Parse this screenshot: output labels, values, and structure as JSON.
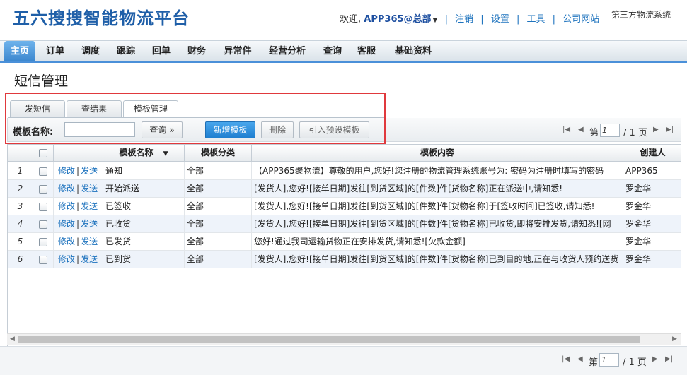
{
  "header": {
    "logo": "五六搜搜智能物流平台",
    "welcome": "欢迎,",
    "user": "APP365@总部",
    "links": [
      "注销",
      "设置",
      "工具",
      "公司网站"
    ],
    "system": "第三方物流系统"
  },
  "nav": {
    "items": [
      "主页",
      "订单",
      "调度",
      "跟踪",
      "回单",
      "财务",
      "异常件",
      "经营分析",
      "查询",
      "客服",
      "基础资料"
    ],
    "active": "主页"
  },
  "page_title": "短信管理",
  "tabs": {
    "items": [
      "发短信",
      "查结果",
      "模板管理"
    ],
    "active": "模板管理"
  },
  "toolbar": {
    "name_label": "模板名称:",
    "name_value": "",
    "search_label": "查询 »",
    "add_label": "新增模板",
    "delete_label": "删除",
    "import_label": "引入预设模板"
  },
  "pager": {
    "prefix": "第",
    "page": "1",
    "total": "/ 1 页"
  },
  "grid": {
    "columns": [
      "",
      "",
      "",
      "模板名称",
      "模板分类",
      "模板内容",
      "创建人"
    ],
    "sort_icon": "sort-down-icon",
    "rows": [
      {
        "no": "1",
        "edit": "修改",
        "send": "发送",
        "name": "通知",
        "category": "全部",
        "content": "【APP365聚物流】尊敬的用户,您好!您注册的物流管理系统账号为: 密码为注册时填写的密码",
        "creator": "APP365"
      },
      {
        "no": "2",
        "edit": "修改",
        "send": "发送",
        "name": "开始派送",
        "category": "全部",
        "content": "[发货人],您好![接单日期]发往[到货区域]的[件数]件[货物名称]正在派送中,请知悉!",
        "creator": "罗金华"
      },
      {
        "no": "3",
        "edit": "修改",
        "send": "发送",
        "name": "已签收",
        "category": "全部",
        "content": "[发货人],您好![接单日期]发往[到货区域]的[件数]件[货物名称]于[签收时间]已签收,请知悉!",
        "creator": "罗金华"
      },
      {
        "no": "4",
        "edit": "修改",
        "send": "发送",
        "name": "已收货",
        "category": "全部",
        "content": "[发货人],您好![接单日期]发往[到货区域]的[件数]件[货物名称]已收货,即将安排发货,请知悉![网",
        "creator": "罗金华"
      },
      {
        "no": "5",
        "edit": "修改",
        "send": "发送",
        "name": "已发货",
        "category": "全部",
        "content": "您好!通过我司运输货物正在安排发货,请知悉![欠款金额]",
        "creator": "罗金华"
      },
      {
        "no": "6",
        "edit": "修改",
        "send": "发送",
        "name": "已到货",
        "category": "全部",
        "content": "[发货人],您好![接单日期]发往[到货区域]的[件数]件[货物名称]已到目的地,正在与收货人预约送货",
        "creator": "罗金华"
      }
    ]
  },
  "colors": {
    "brand": "#1f5fa8",
    "link": "#1e73be",
    "primary_button": "#2a8ad8",
    "highlight_box": "#e0393d"
  }
}
